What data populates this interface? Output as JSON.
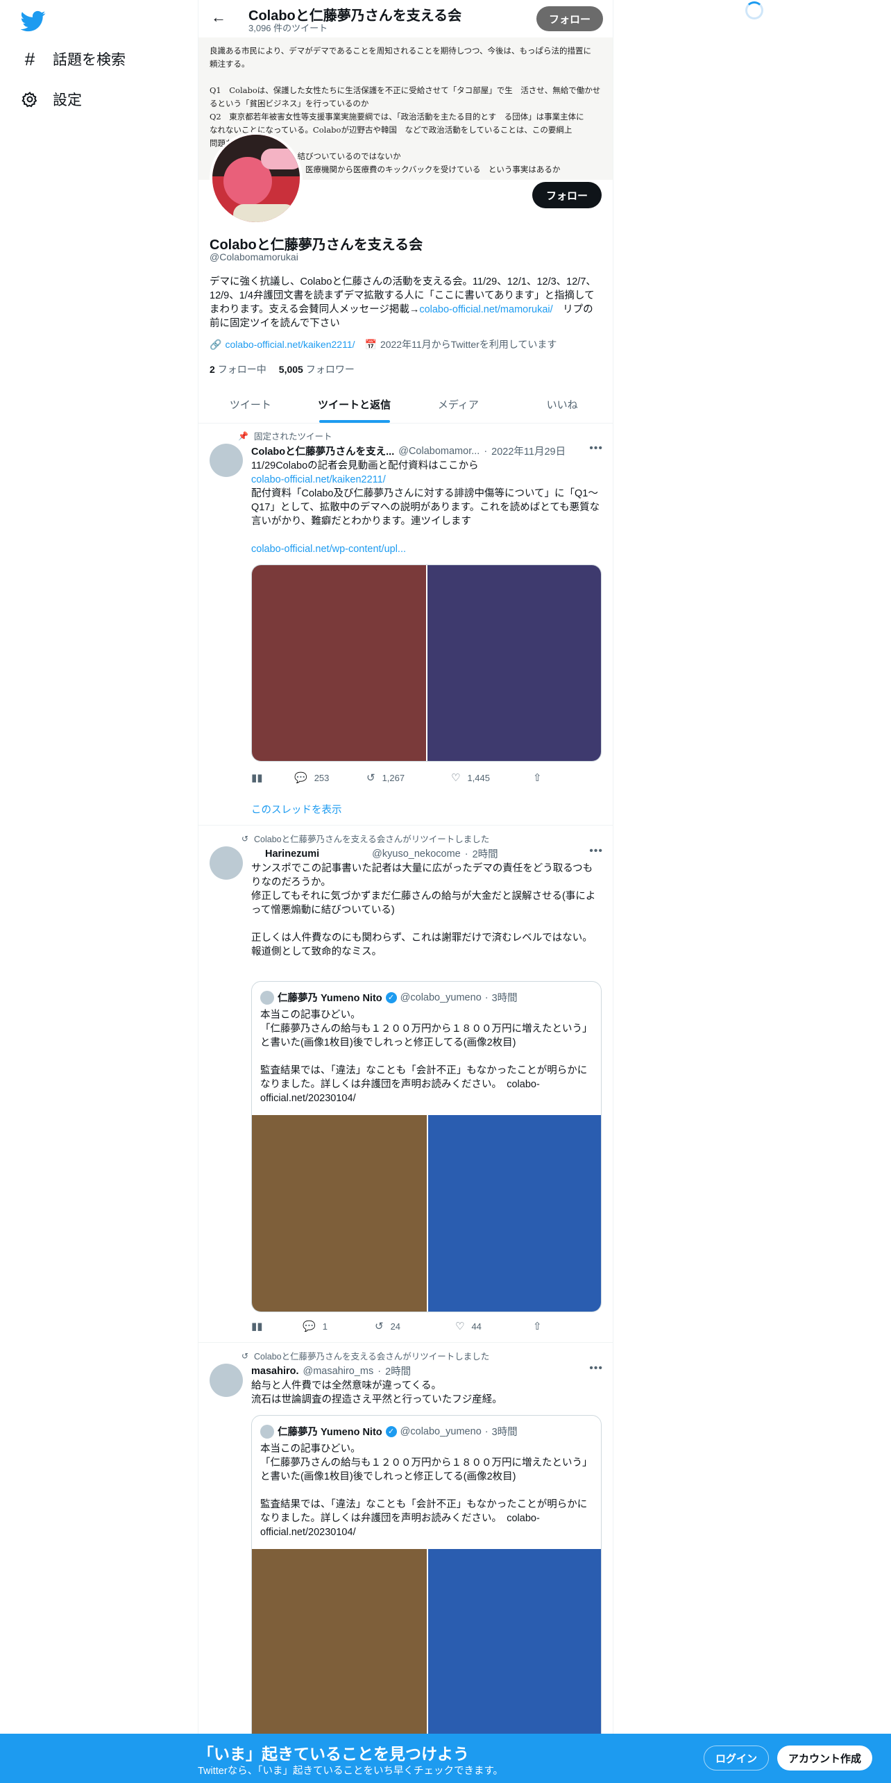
{
  "nav": {
    "explore_label": "話題を検索",
    "settings_label": "設定"
  },
  "header": {
    "title": "Colaboと仁藤夢乃さんを支える会",
    "tweet_count": "3,096 件のツイート",
    "follow_label": "フォロー"
  },
  "banner": {
    "text": "良識ある市民により、デマがデマであることを周知されることを期待しつつ、今後は、もっぱら法的措置に\n頼注する。\n\nQ1　Colaboは、保護した女性たちに生活保護を不正に受給させて「タコ部屋」で生　活させ、無給で働かせ\nるという「貧困ビジネス」を行っているのか\nQ2　東京都若年被害女性等支援事業実施要綱では、「政治活動を主たる目的とす　る団体」は事業主体に\nなれないことになっている。Colaboが辺野古や韓国　などで政治活動をしていることは、この要綱上\n問題ないのか\n　　　　　　　　と強く結びついているのではないか\n　　　　　　　　に際し、医療機関から医療費のキックバックを受けている　という事実はあるか"
  },
  "profile": {
    "name": "Colaboと仁藤夢乃さんを支える会",
    "handle": "@Colabomamorukai",
    "follow_label": "フォロー",
    "bio_text": "デマに強く抗議し、Colaboと仁藤さんの活動を支える会。11/29、12/1、12/3、12/7、12/9、1/4弁護団文書を読まずデマ拡散する人に「ここに書いてあります」と指摘してまわります。支える会賛同人メッセージ掲載→",
    "bio_link": "colabo-official.net/mamorukai/",
    "bio_tail": "　リプの前に固定ツイを読んで下さい",
    "website": "colabo-official.net/kaiken2211/",
    "joined": "2022年11月からTwitterを利用しています",
    "following_count": "2",
    "following_label": "フォロー中",
    "followers_count": "5,005",
    "followers_label": "フォロワー"
  },
  "tabs": [
    "ツイート",
    "ツイートと返信",
    "メディア",
    "いいね"
  ],
  "tweets": [
    {
      "context": "固定されたツイート",
      "name": "Colaboと仁藤夢乃さんを支え...",
      "handle": "@Colabomamor...",
      "time": "2022年11月29日",
      "body_line1": "11/29Colaboの記者会見動画と配付資料はここから",
      "body_link1": "colabo-official.net/kaiken2211/",
      "body_line2": "配付資料「Colabo及び仁藤夢乃さんに対する誹謗中傷等について」に「Q1～Q17」として、拡散中のデマへの説明があります。これを読めばとても悪質な言いがかり、難癖だとわかります。連ツイします",
      "body_link2": "colabo-official.net/wp-content/upl...",
      "img_left_color": "#7a3a3a",
      "img_right_color": "#3e3a6e",
      "replies": "253",
      "retweets": "1,267",
      "likes": "1,445",
      "show_thread": "このスレッドを表示"
    },
    {
      "context": "Colaboと仁藤夢乃さんを支える会さんがリツイートしました",
      "name": "Harinezumi",
      "handle": "@kyuso_nekocome",
      "time": "2時間",
      "body": "サンスポでこの記事書いた記者は大量に広がったデマの責任をどう取るつもりなのだろうか。\n修正してもそれに気づかずまだ仁藤さんの給与が大金だと誤解させる(事によって憎悪煽動に結びついている)\n\n正しくは人件費なのにも関わらず、これは謝罪だけで済むレベルではない。\n報道側として致命的なミス。",
      "quote": {
        "name": "仁藤夢乃 Yumeno Nito",
        "handle": "@colabo_yumeno",
        "time": "3時間",
        "body": "本当この記事ひどい。\n「仁藤夢乃さんの給与も１２００万円から１８００万円に増えたという」と書いた(画像1枚目)後でしれっと修正してる(画像2枚目)\n\n監査結果では、「違法」なことも「会計不正」もなかったことが明らかになりました。詳しくは弁護団を声明お読みください。　colabo-official.net/20230104/",
        "img_left_color": "#7e5f3a",
        "img_right_color": "#2a5db0"
      },
      "replies": "1",
      "retweets": "24",
      "likes": "44"
    },
    {
      "context": "Colaboと仁藤夢乃さんを支える会さんがリツイートしました",
      "name": "masahiro.",
      "handle": "@masahiro_ms",
      "time": "2時間",
      "body": "給与と人件費では全然意味が違ってくる。\n流石は世論調査の捏造さえ平然と行っていたフジ産経。",
      "quote": {
        "name": "仁藤夢乃 Yumeno Nito",
        "handle": "@colabo_yumeno",
        "time": "3時間",
        "body": "本当この記事ひどい。\n「仁藤夢乃さんの給与も１２００万円から１８００万円に増えたという」と書いた(画像1枚目)後でしれっと修正してる(画像2枚目)\n\n監査結果では、「違法」なことも「会計不正」もなかったことが明らかになりました。詳しくは弁護団を声明お読みください。　colabo-official.net/20230104/",
        "img_left_color": "#7e5f3a",
        "img_right_color": "#2a5db0"
      }
    }
  ],
  "bottom": {
    "title": "「いま」起きていることを見つけよう",
    "subtitle": "Twitterなら、「いま」起きていることをいち早くチェックできます。",
    "login_label": "ログイン",
    "signup_label": "アカウント作成"
  },
  "colors": {
    "accent": "#1d9bf0",
    "text": "#0f1419",
    "muted": "#536471"
  }
}
